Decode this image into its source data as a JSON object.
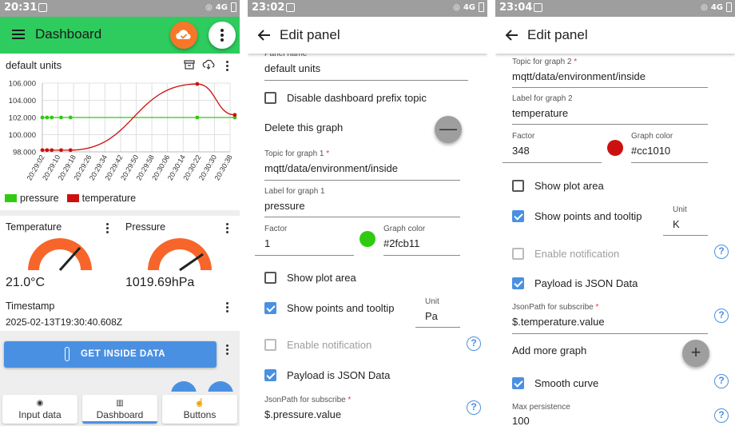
{
  "screen1": {
    "status": {
      "time": "20:31",
      "network": "4G"
    },
    "appbar": {
      "title": "Dashboard"
    },
    "chart_card": {
      "title": "default units"
    },
    "chart_data": {
      "type": "line",
      "x": [
        "20:29:02",
        "20:29:10",
        "20:29:18",
        "20:29:26",
        "20:29:34",
        "20:29:42",
        "20:29:50",
        "20:29:58",
        "20:30:06",
        "20:30:14",
        "20:30:22",
        "20:30:30",
        "20:30:38"
      ],
      "ylim": [
        98.0,
        106.0
      ],
      "yticks": [
        "106.000",
        "104.000",
        "102.000",
        "100.000",
        "98.000"
      ],
      "series": [
        {
          "name": "pressure",
          "color": "#2fcb11",
          "points": [
            [
              0,
              102
            ],
            [
              0.3,
              102
            ],
            [
              0.6,
              102
            ],
            [
              1.2,
              102
            ],
            [
              1.8,
              102
            ],
            [
              9.9,
              102
            ],
            [
              12.3,
              102
            ]
          ]
        },
        {
          "name": "temperature",
          "color": "#cc1010",
          "points": [
            [
              0,
              98.2
            ],
            [
              0.3,
              98.2
            ],
            [
              0.6,
              98.2
            ],
            [
              1.2,
              98.2
            ],
            [
              1.8,
              98.2
            ],
            [
              9.9,
              105.9
            ],
            [
              12.3,
              102.3
            ]
          ]
        }
      ],
      "grid": true,
      "legend": "bottom-left"
    },
    "temperature": {
      "label": "Temperature",
      "value": "21.0°C"
    },
    "pressure": {
      "label": "Pressure",
      "value": "1019.69hPa"
    },
    "timestamp": {
      "label": "Timestamp",
      "value": "2025-02-13T19:30:40.608Z"
    },
    "button": {
      "label": "GET INSIDE DATA"
    },
    "nav": [
      {
        "label": "Input data"
      },
      {
        "label": "Dashboard"
      },
      {
        "label": "Buttons"
      }
    ]
  },
  "screen2": {
    "status": {
      "time": "23:02",
      "network": "4G"
    },
    "appbar": {
      "title": "Edit panel"
    },
    "panel_name": {
      "label": "Panel name",
      "value": "default units"
    },
    "disable_prefix": {
      "label": "Disable dashboard prefix topic",
      "checked": false
    },
    "delete_graph": {
      "label": "Delete this graph",
      "icon": "—"
    },
    "topic1": {
      "label": "Topic for graph 1",
      "value": "mqtt/data/environment/inside"
    },
    "label1": {
      "label": "Label for graph 1",
      "value": "pressure"
    },
    "factor": {
      "label": "Factor",
      "value": "1"
    },
    "color": {
      "label": "Graph color",
      "value": "#2fcb11",
      "swatch": "#2fcb11"
    },
    "show_plot_area": {
      "label": "Show plot area"
    },
    "show_points": {
      "label": "Show points and tooltip"
    },
    "unit": {
      "label": "Unit",
      "value": "Pa"
    },
    "enable_notification": {
      "label": "Enable notification"
    },
    "payload_json": {
      "label": "Payload is JSON Data"
    },
    "jsonpath": {
      "label": "JsonPath for subscribe",
      "value": "$.pressure.value"
    },
    "help": "?"
  },
  "screen3": {
    "status": {
      "time": "23:04",
      "network": "4G"
    },
    "appbar": {
      "title": "Edit panel"
    },
    "topic2": {
      "label": "Topic for graph 2",
      "value": "mqtt/data/environment/inside"
    },
    "label2": {
      "label": "Label for graph 2",
      "value": "temperature"
    },
    "factor": {
      "label": "Factor",
      "value": "348"
    },
    "color": {
      "label": "Graph color",
      "value": "#cc1010",
      "swatch": "#cc1010"
    },
    "show_plot_area": {
      "label": "Show plot area"
    },
    "show_points": {
      "label": "Show points and tooltip"
    },
    "unit": {
      "label": "Unit",
      "value": "K"
    },
    "enable_notification": {
      "label": "Enable notification"
    },
    "payload_json": {
      "label": "Payload is JSON Data"
    },
    "jsonpath": {
      "label": "JsonPath for subscribe",
      "value": "$.temperature.value"
    },
    "add_graph": {
      "label": "Add more graph",
      "icon": "+"
    },
    "smooth_curve": {
      "label": "Smooth curve"
    },
    "max_persistence": {
      "label": "Max persistence",
      "value": "100"
    },
    "help": "?",
    "required_mark": "*"
  }
}
